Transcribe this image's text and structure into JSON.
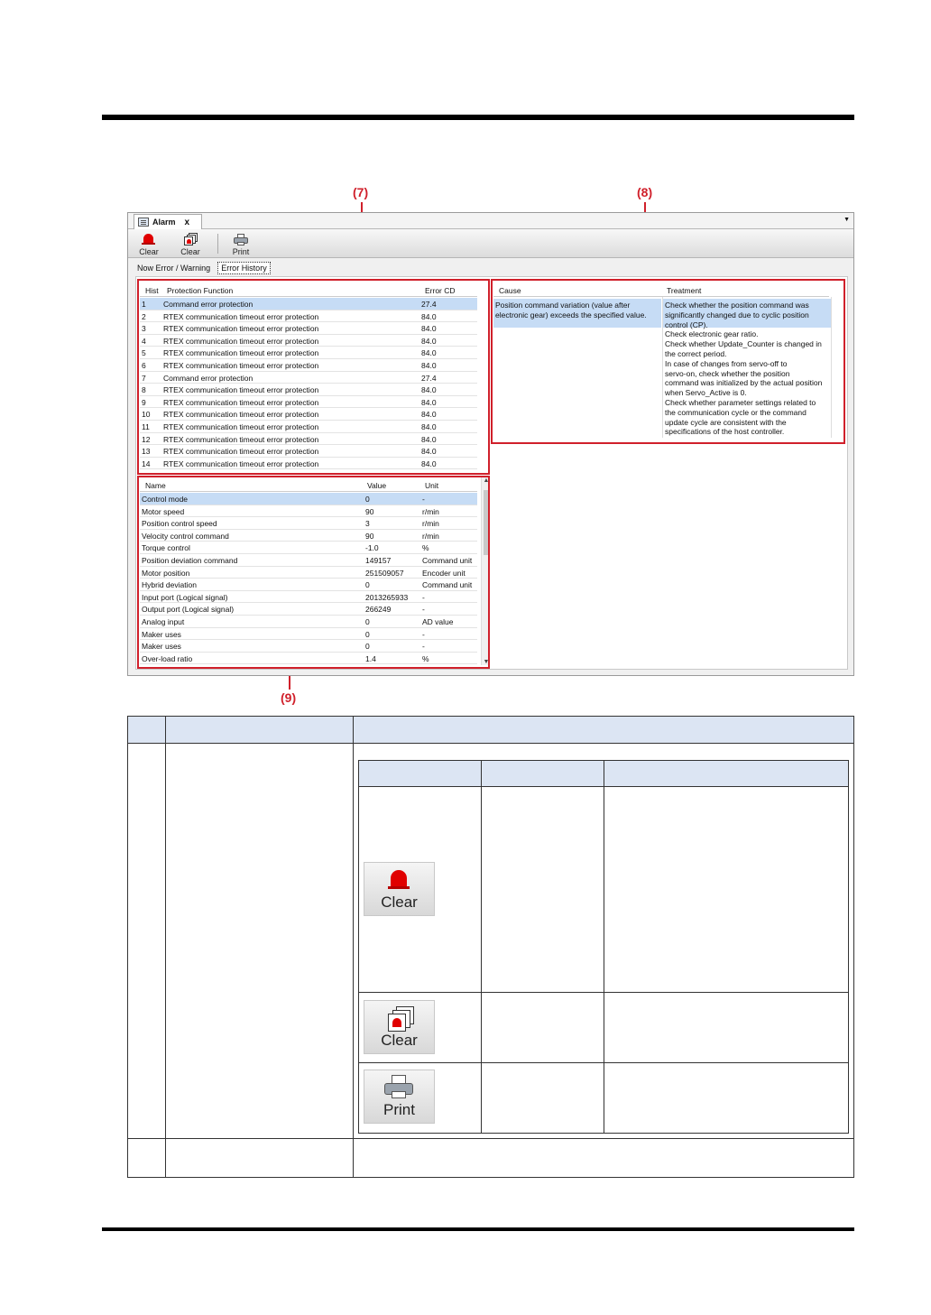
{
  "callouts": {
    "c7": "(7)",
    "c8": "(8)",
    "c9": "(9)"
  },
  "window": {
    "tab_title": "Alarm",
    "tab_close": "x",
    "toolbar": {
      "clear": "Clear",
      "clear_all": "Clear",
      "print": "Print"
    },
    "subtabs": {
      "now": "Now Error / Warning",
      "history": "Error History"
    }
  },
  "history": {
    "headers": {
      "hist": "Hist",
      "function": "Protection Function",
      "code": "Error CD"
    },
    "rows": [
      {
        "hist": "1",
        "function": "Command error protection",
        "code": "27.4"
      },
      {
        "hist": "2",
        "function": "RTEX communication timeout error protection",
        "code": "84.0"
      },
      {
        "hist": "3",
        "function": "RTEX communication timeout error protection",
        "code": "84.0"
      },
      {
        "hist": "4",
        "function": "RTEX communication timeout error protection",
        "code": "84.0"
      },
      {
        "hist": "5",
        "function": "RTEX communication timeout error protection",
        "code": "84.0"
      },
      {
        "hist": "6",
        "function": "RTEX communication timeout error protection",
        "code": "84.0"
      },
      {
        "hist": "7",
        "function": "Command error protection",
        "code": "27.4"
      },
      {
        "hist": "8",
        "function": "RTEX communication timeout error protection",
        "code": "84.0"
      },
      {
        "hist": "9",
        "function": "RTEX communication timeout error protection",
        "code": "84.0"
      },
      {
        "hist": "10",
        "function": "RTEX communication timeout error protection",
        "code": "84.0"
      },
      {
        "hist": "11",
        "function": "RTEX communication timeout error protection",
        "code": "84.0"
      },
      {
        "hist": "12",
        "function": "RTEX communication timeout error protection",
        "code": "84.0"
      },
      {
        "hist": "13",
        "function": "RTEX communication timeout error protection",
        "code": "84.0"
      },
      {
        "hist": "14",
        "function": "RTEX communication timeout error protection",
        "code": "84.0"
      }
    ]
  },
  "cause": {
    "headers": {
      "cause": "Cause",
      "treatment": "Treatment"
    },
    "cause_lines": [
      "Position command variation (value after",
      "electronic gear) exceeds the specified value."
    ],
    "treatment_lines": [
      "Check whether the position command was",
      "significantly changed due to cyclic position",
      "control (CP).",
      "Check electronic gear ratio.",
      "Check whether Update_Counter is changed in",
      "the correct period.",
      "In case of changes from servo-off to",
      "servo-on, check whether the position",
      "command was initialized by the actual position",
      "when Servo_Active is 0.",
      "Check whether parameter settings related to",
      "the communication cycle or the command",
      "update cycle are consistent with the",
      "specifications of the host controller."
    ]
  },
  "monitor": {
    "headers": {
      "name": "Name",
      "value": "Value",
      "unit": "Unit"
    },
    "rows": [
      {
        "name": "Control mode",
        "value": "0",
        "unit": "-"
      },
      {
        "name": "Motor speed",
        "value": "90",
        "unit": "r/min"
      },
      {
        "name": "Position control speed",
        "value": "3",
        "unit": "r/min"
      },
      {
        "name": "Velocity control command",
        "value": "90",
        "unit": "r/min"
      },
      {
        "name": "Torque control",
        "value": "-1.0",
        "unit": "%"
      },
      {
        "name": "Position deviation command",
        "value": "149157",
        "unit": "Command unit"
      },
      {
        "name": "Motor position",
        "value": "251509057",
        "unit": "Encoder unit"
      },
      {
        "name": "Hybrid deviation",
        "value": "0",
        "unit": "Command unit"
      },
      {
        "name": "Input port (Logical signal)",
        "value": "2013265933",
        "unit": "-"
      },
      {
        "name": "Output port (Logical signal)",
        "value": "266249",
        "unit": "-"
      },
      {
        "name": "Analog input",
        "value": "0",
        "unit": "AD value"
      },
      {
        "name": "Maker uses",
        "value": "0",
        "unit": "-"
      },
      {
        "name": "Maker uses",
        "value": "0",
        "unit": "-"
      },
      {
        "name": "Over-load ratio",
        "value": "1.4",
        "unit": "%"
      }
    ]
  },
  "spec_icons": {
    "clear": "Clear",
    "clear_all": "Clear",
    "print": "Print"
  },
  "colors": {
    "callout_red": "#d0202b",
    "selection": "#c6dcf5",
    "table_header": "#dce5f3"
  }
}
